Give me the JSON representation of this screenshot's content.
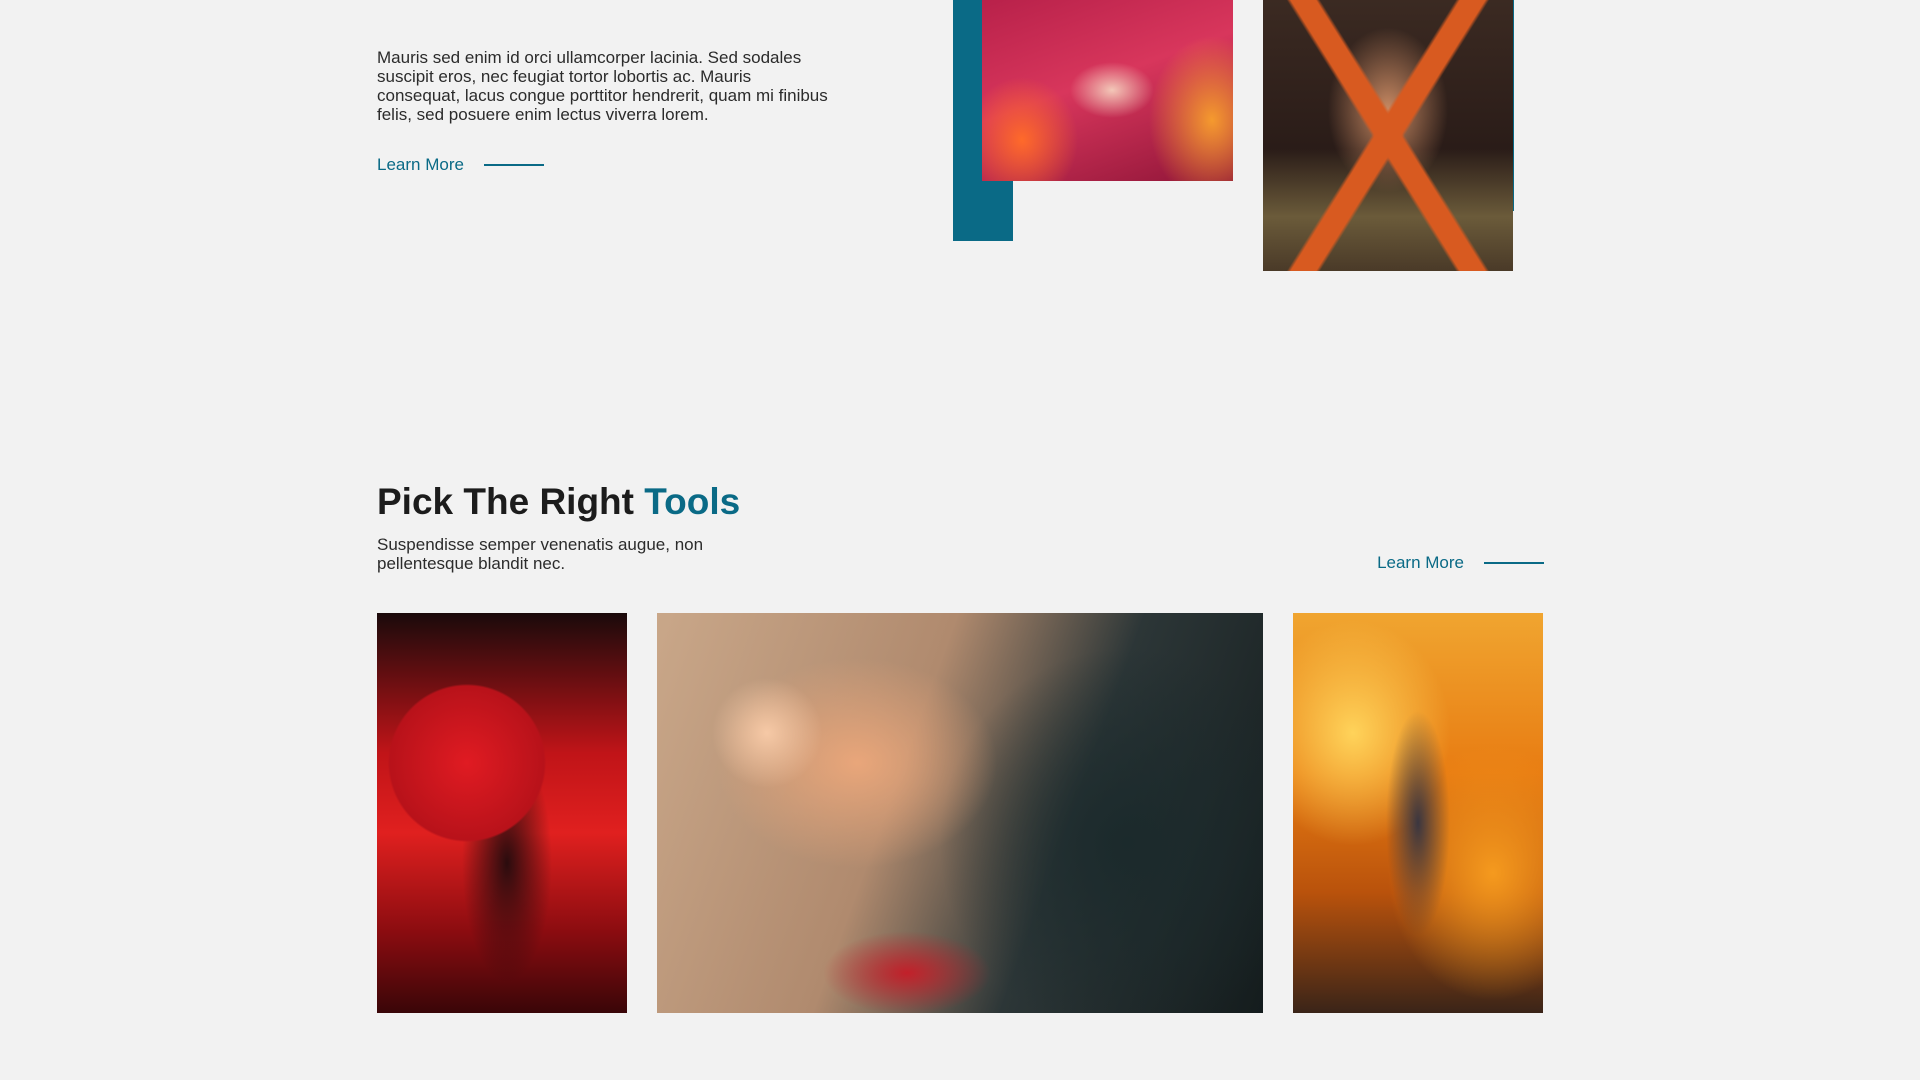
{
  "intro": {
    "paragraph": "Mauris sed enim id orci ullamcorper lacinia. Sed sodales suscipit eros, nec feugiat tortor lobortis ac. Mauris consequat, lacus congue porttitor hendrerit, quam mi finibus felis, sed posuere enim lectus viverra lorem.",
    "learn_more": "Learn More"
  },
  "tools": {
    "title_main": "Pick The Right ",
    "title_accent": "Tools",
    "subtitle": "Suspendisse semper venenatis augue, non pellentesque blandit nec.",
    "learn_more": "Learn More"
  },
  "colors": {
    "accent": "#0a6a86",
    "background": "#f2f2f2",
    "text": "#222222"
  }
}
